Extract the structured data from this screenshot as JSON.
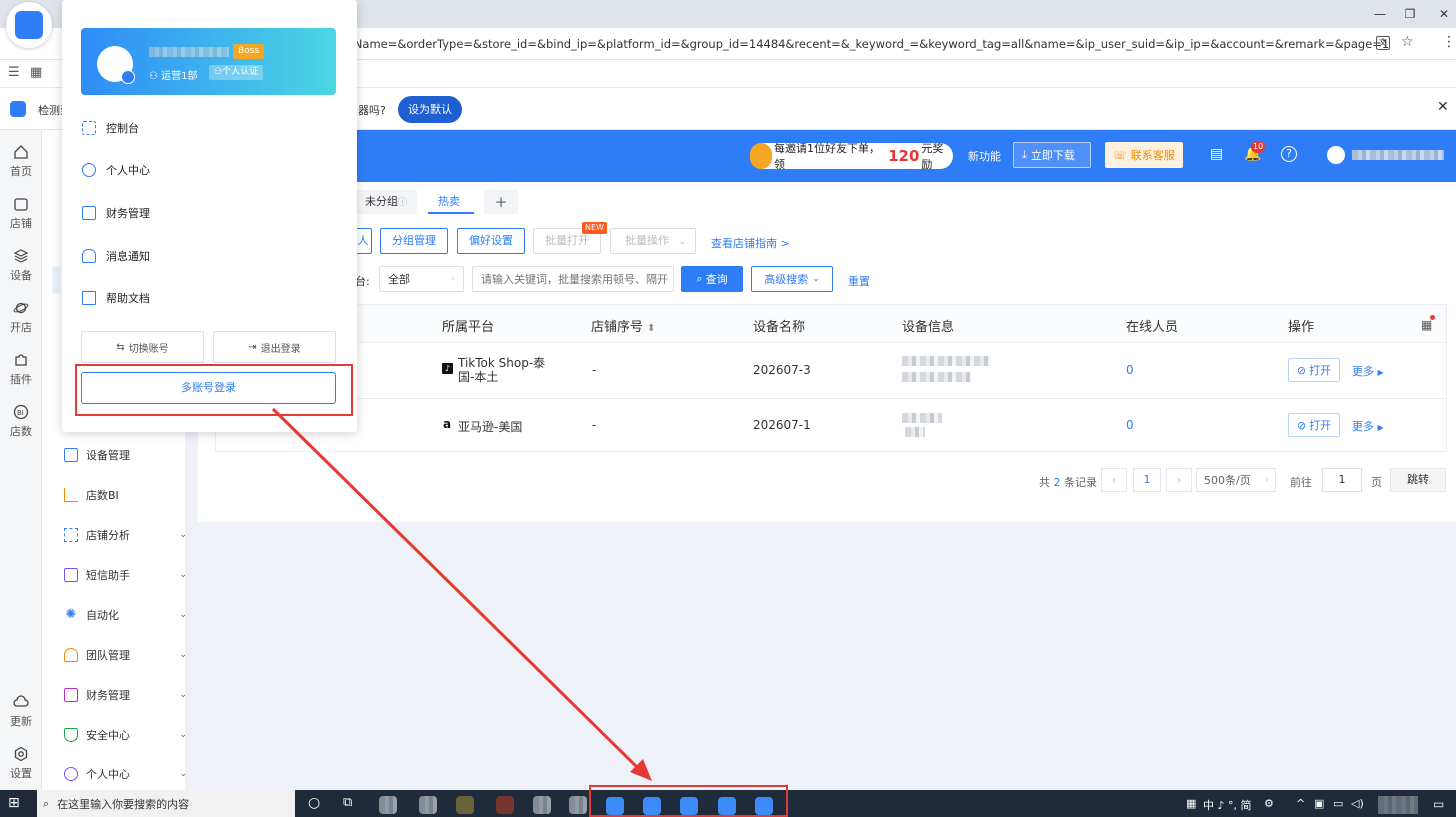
{
  "browser": {
    "url": "erName=&orderType=&store_id=&bind_ip=&platform_id=&group_id=14484&recent=&_keyword_=&keyword_tag=all&name=&ip_user_suid=&ip_ip=&account=&remark=&page=1",
    "infobar_text_prefix": "检测到",
    "infobar_text_suffix": "器吗?",
    "set_default_label": "设为默认"
  },
  "header": {
    "promo_text_prefix": "每邀请1位好友下单，领",
    "promo_amount": "120",
    "promo_text_suffix": "元奖励",
    "new_feature": "新功能",
    "download": "立即下载",
    "support": "联系客服",
    "notification_count": "10"
  },
  "rail": [
    {
      "label": "首页",
      "icon": "home-icon"
    },
    {
      "label": "店铺",
      "icon": "store-icon"
    },
    {
      "label": "设备",
      "icon": "layers-icon"
    },
    {
      "label": "开店",
      "icon": "planet-icon"
    },
    {
      "label": "插件",
      "icon": "puzzle-icon"
    },
    {
      "label": "店数",
      "icon": "bi-icon"
    },
    {
      "label": "更新",
      "icon": "cloud-icon"
    },
    {
      "label": "设置",
      "icon": "settings-icon"
    }
  ],
  "sidenav": [
    {
      "label": "设备管理",
      "icon": "device-icon",
      "chev": false
    },
    {
      "label": "店数BI",
      "icon": "bar-chart-icon",
      "chev": false
    },
    {
      "label": "店铺分析",
      "icon": "grid-icon",
      "chev": true
    },
    {
      "label": "短信助手",
      "icon": "message-icon",
      "chev": true
    },
    {
      "label": "自动化",
      "icon": "sun-icon",
      "chev": true
    },
    {
      "label": "团队管理",
      "icon": "team-icon",
      "chev": true
    },
    {
      "label": "财务管理",
      "icon": "wallet-icon",
      "chev": true
    },
    {
      "label": "安全中心",
      "icon": "shield-icon",
      "chev": true
    },
    {
      "label": "个人中心",
      "icon": "user-icon",
      "chev": true
    }
  ],
  "tabs": [
    "未分组",
    "热卖"
  ],
  "toolbar": {
    "group_manage": "分组管理",
    "preference": "偏好设置",
    "batch_open": "批量打开",
    "new_badge": "NEW",
    "batch_ops": "批量操作",
    "guide_link": "查看店铺指南 >",
    "platform_label_suffix": "台:",
    "platform_value": "全部",
    "search_placeholder": "请输入关键词，批量搜索用顿号、隔开",
    "query": "查询",
    "advanced": "高级搜索",
    "reset": "重置"
  },
  "table": {
    "headers": [
      "所属平台",
      "店铺序号",
      "设备名称",
      "设备信息",
      "在线人员",
      "操作"
    ],
    "rows": [
      {
        "platform": "TikTok Shop-泰国-本土",
        "seq": "-",
        "device": "202607-3",
        "online": "0",
        "open": "打开",
        "more": "更多"
      },
      {
        "platform": "亚马逊-美国",
        "seq": "-",
        "device": "202607-1",
        "online": "0",
        "open": "打开",
        "more": "更多"
      }
    ]
  },
  "pagination": {
    "total_prefix": "共",
    "total": "2",
    "total_suffix": "条记录",
    "page": "1",
    "size": "500条/页",
    "goto": "前往",
    "goto_value": "1",
    "page_unit": "页",
    "jump": "跳转"
  },
  "popup": {
    "badge": "Boss",
    "department": "运营1部",
    "verify": "个人认证",
    "items": [
      {
        "label": "控制台",
        "icon": "dashboard-icon"
      },
      {
        "label": "个人中心",
        "icon": "user-circle-icon"
      },
      {
        "label": "财务管理",
        "icon": "wallet-icon"
      },
      {
        "label": "消息通知",
        "icon": "bell-icon"
      },
      {
        "label": "帮助文档",
        "icon": "book-icon"
      }
    ],
    "switch_account": "切换账号",
    "logout": "退出登录",
    "multi_login": "多账号登录"
  },
  "taskbar": {
    "search_placeholder": "在这里输入你要搜索的内容",
    "tray_text": "中 ♪ °, 简"
  },
  "colors": {
    "primary": "#2f7df6",
    "accent_red": "#e53935",
    "orange": "#f5a623"
  }
}
